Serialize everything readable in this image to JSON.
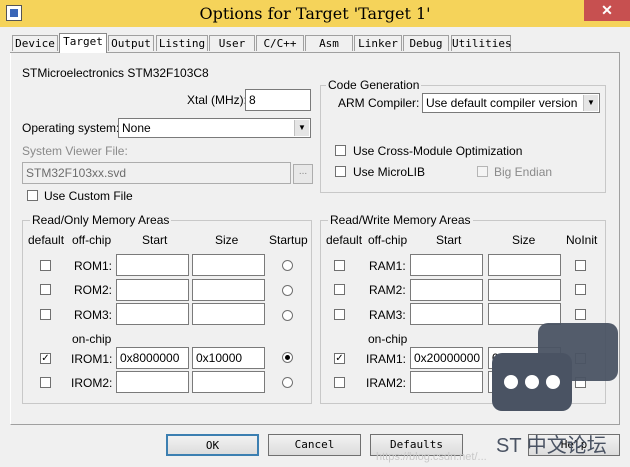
{
  "window": {
    "title": "Options for Target 'Target 1'",
    "close_glyph": "✕"
  },
  "tabs": [
    "Device",
    "Target",
    "Output",
    "Listing",
    "User",
    "C/C++",
    "Asm",
    "Linker",
    "Debug",
    "Utilities"
  ],
  "device": {
    "name": "STMicroelectronics STM32F103C8"
  },
  "xtal": {
    "label": "Xtal (MHz):",
    "value": "8"
  },
  "os": {
    "label": "Operating system:",
    "value": "None"
  },
  "svd": {
    "label": "System Viewer File:",
    "value": "STM32F103xx.svd",
    "browse": "..."
  },
  "custom_file": {
    "label": "Use Custom File",
    "checked": false
  },
  "codegen": {
    "title": "Code Generation",
    "compiler_label": "ARM Compiler:",
    "compiler_value": "Use default compiler version",
    "cross_module": "Use Cross-Module Optimization",
    "microlib": "Use MicroLIB",
    "big_endian": "Big Endian"
  },
  "rom": {
    "title": "Read/Only Memory Areas",
    "headers": {
      "default": "default",
      "offchip": "off-chip",
      "start": "Start",
      "size": "Size",
      "startup": "Startup",
      "onchip": "on-chip"
    },
    "rows": [
      {
        "name": "ROM1:",
        "start": "",
        "size": ""
      },
      {
        "name": "ROM2:",
        "start": "",
        "size": ""
      },
      {
        "name": "ROM3:",
        "start": "",
        "size": ""
      },
      {
        "name": "IROM1:",
        "start": "0x8000000",
        "size": "0x10000"
      },
      {
        "name": "IROM2:",
        "start": "",
        "size": ""
      }
    ]
  },
  "ram": {
    "title": "Read/Write Memory Areas",
    "headers": {
      "default": "default",
      "offchip": "off-chip",
      "start": "Start",
      "size": "Size",
      "noinit": "NoInit",
      "onchip": "on-chip"
    },
    "rows": [
      {
        "name": "RAM1:",
        "start": "",
        "size": ""
      },
      {
        "name": "RAM2:",
        "start": "",
        "size": ""
      },
      {
        "name": "RAM3:",
        "start": "",
        "size": ""
      },
      {
        "name": "IRAM1:",
        "start": "0x20000000",
        "size": "0x5000"
      },
      {
        "name": "IRAM2:",
        "start": "",
        "size": ""
      }
    ]
  },
  "buttons": {
    "ok": "OK",
    "cancel": "Cancel",
    "defaults": "Defaults",
    "help": "Help"
  },
  "watermark": {
    "text": "ST 中文论坛",
    "url": "https://blog.csdn.net/..."
  },
  "icons": {
    "app": "keil-app-icon",
    "close": "close-icon",
    "dropdown": "chevron-down-icon",
    "check": "checkmark-icon"
  }
}
